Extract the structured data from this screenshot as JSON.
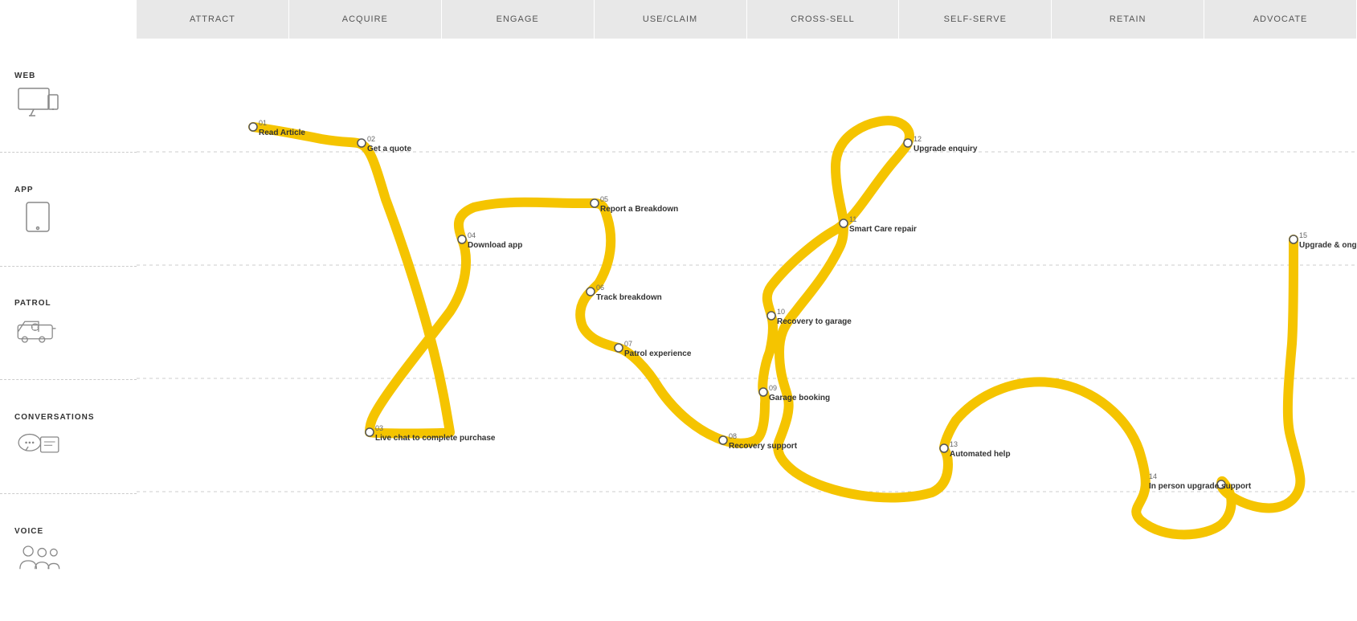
{
  "header": {
    "columns": [
      "ATTRACT",
      "ACQUIRE",
      "ENGAGE",
      "USE/CLAIM",
      "CROSS-SELL",
      "SELF-SERVE",
      "RETAIN",
      "ADVOCATE"
    ]
  },
  "sidebar": {
    "rows": [
      {
        "label": "WEB",
        "icon": "monitor"
      },
      {
        "label": "APP",
        "icon": "tablet"
      },
      {
        "label": "PATROL",
        "icon": "van"
      },
      {
        "label": "CONVERSATIONS",
        "icon": "chat"
      },
      {
        "label": "VOICE",
        "icon": "people"
      }
    ]
  },
  "touchpoints": [
    {
      "id": "01",
      "label": "Read Article"
    },
    {
      "id": "02",
      "label": "Get a quote"
    },
    {
      "id": "03",
      "label": "Live chat to complete purchase"
    },
    {
      "id": "04",
      "label": "Download app"
    },
    {
      "id": "05",
      "label": "Report a Breakdown"
    },
    {
      "id": "06",
      "label": "Track breakdown"
    },
    {
      "id": "07",
      "label": "Patrol experience"
    },
    {
      "id": "08",
      "label": "Recovery support"
    },
    {
      "id": "09",
      "label": "Garage booking"
    },
    {
      "id": "10",
      "label": "Recovery to garage"
    },
    {
      "id": "11",
      "label": "Smart Care repair"
    },
    {
      "id": "12",
      "label": "Upgrade enquiry"
    },
    {
      "id": "13",
      "label": "Automated help"
    },
    {
      "id": "14",
      "label": "In person upgrade support"
    },
    {
      "id": "15",
      "label": "Upgrade & ongoing use"
    }
  ]
}
